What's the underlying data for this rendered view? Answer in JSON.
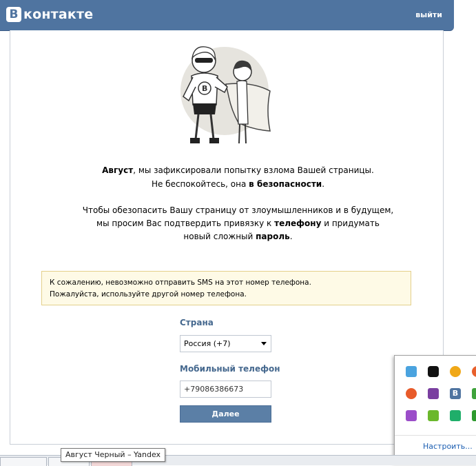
{
  "header": {
    "logo_letter": "В",
    "logo_text": "контакте",
    "logout": "выйти"
  },
  "message": {
    "line1_name": "Август",
    "line1_rest": ", мы зафиксировали попытку взлома Вашей страницы.",
    "line2_start": "Не беспокойтесь, она ",
    "line2_bold": "в безопасности",
    "line2_end": ".",
    "line3": "Чтобы обезопасить Вашу страницу от злоумышленников и в будущем,",
    "line4_start": "мы просим Вас подтвердить привязку к ",
    "line4_bold": "телефону",
    "line4_end": " и придумать",
    "line5_start": "новый сложный ",
    "line5_bold": "пароль",
    "line5_end": "."
  },
  "warning": {
    "line1": "К сожалению, невозможно отправить SMS на этот номер телефона.",
    "line2": "Пожалуйста, используйте другой номер телефона."
  },
  "form": {
    "country_label": "Страна",
    "country_value": "Россия (+7)",
    "phone_label": "Мобильный телефон",
    "phone_value": "+79086386673",
    "submit": "Далее"
  },
  "tray": {
    "configure": "Настроить...",
    "colors": {
      "accent": "#4f74a0",
      "label": "#45688e",
      "warning_bg": "#fefae6",
      "warning_border": "#e3cf8a"
    }
  },
  "tooltip": "Август Черный – Yandex"
}
